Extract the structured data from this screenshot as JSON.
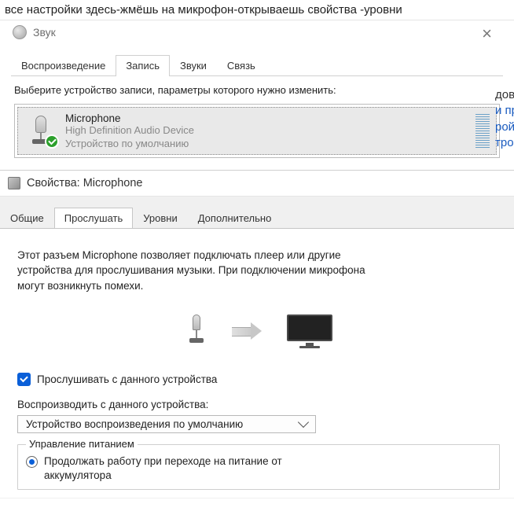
{
  "caption": "все настройки здесь-жмёшь на микрофон-открываешь свойства -уровни",
  "sound": {
    "title": "Звук",
    "tabs": [
      "Воспроизведение",
      "Запись",
      "Звуки",
      "Связь"
    ],
    "active_tab_index": 1,
    "prompt": "Выберите устройство записи, параметры которого нужно изменить:",
    "device": {
      "name": "Microphone",
      "desc": "High Definition Audio Device",
      "status": "Устройство по умолчанию"
    }
  },
  "side": {
    "line1": "дов",
    "line2": "и пр",
    "line3": "рой",
    "line4": "тро"
  },
  "props": {
    "title": "Свойства: Microphone",
    "tabs": [
      "Общие",
      "Прослушать",
      "Уровни",
      "Дополнительно"
    ],
    "active_tab_index": 1,
    "desc": "Этот разъем Microphone позволяет подключать плеер или другие устройства для прослушивания музыки. При подключении микрофона могут возникнуть помехи.",
    "listen_label": "Прослушивать с данного устройства",
    "listen_checked": true,
    "playback_label": "Воспроизводить с данного устройства:",
    "playback_value": "Устройство воспроизведения по умолчанию",
    "group_title": "Управление питанием",
    "radio1_label": "Продолжать работу при переходе на питание от аккумулятора",
    "radio1_checked": true
  }
}
